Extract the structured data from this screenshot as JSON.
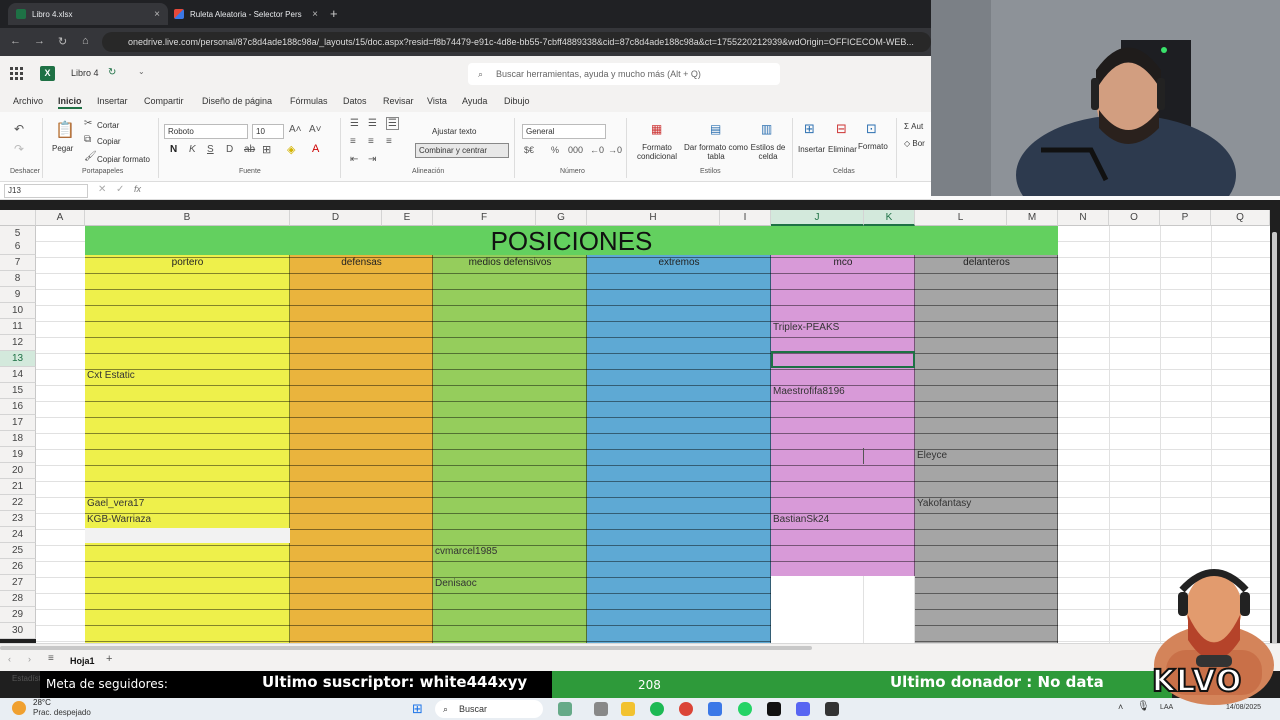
{
  "browser": {
    "tabs": [
      {
        "title": "Libro 4.xlsx",
        "color": "#1e7145"
      },
      {
        "title": "Ruleta Aleatoria - Selector Pers",
        "color": "#e5493a"
      }
    ],
    "url": "onedrive.live.com/personal/87c8d4ade188c98a/_layouts/15/doc.aspx?resid=f8b74479-e91c-4d8e-bb55-7cbff4889338&cid=87c8d4ade188c98a&ct=1755220212939&wdOrigin=OFFICECOM-WEB..."
  },
  "excel": {
    "doc_name": "Libro 4",
    "search_placeholder": "Buscar herramientas, ayuda y mucho más (Alt + Q)",
    "menus": [
      "Archivo",
      "Inicio",
      "Insertar",
      "Compartir",
      "Diseño de página",
      "Fórmulas",
      "Datos",
      "Revisar",
      "Vista",
      "Ayuda",
      "Dibujo"
    ],
    "ribbon": {
      "undo": "Deshacer",
      "paste": "Pegar",
      "cut": "Cortar",
      "copy": "Copiar",
      "format_painter": "Copiar formato",
      "clipboard_group": "Portapapeles",
      "font_name": "Roboto",
      "font_size": "10",
      "font_group": "Fuente",
      "wrap_text": "Ajustar texto",
      "merge_center": "Combinar y centrar",
      "alignment_group": "Alineación",
      "number_format": "General",
      "number_group": "Número",
      "cond_format": "Formato condicional",
      "format_table": "Dar formato como tabla",
      "cell_styles": "Estilos de celda",
      "styles_group": "Estilos",
      "insert": "Insertar",
      "delete": "Eliminar",
      "format": "Formato",
      "cells_group": "Celdas",
      "autosum": "Aut",
      "clear": "Bor"
    },
    "name_box": "J13",
    "columns": [
      "A",
      "B",
      "D",
      "E",
      "F",
      "G",
      "H",
      "I",
      "J",
      "K",
      "L",
      "M",
      "N",
      "O",
      "P",
      "Q"
    ],
    "rows": [
      "5",
      "6",
      "7",
      "8",
      "9",
      "10",
      "11",
      "12",
      "13",
      "14",
      "15",
      "16",
      "17",
      "18",
      "19",
      "20",
      "21",
      "22",
      "23",
      "24",
      "25",
      "26",
      "27",
      "28",
      "29",
      "30"
    ],
    "sheet_title": "POSICIONES",
    "position_headers": [
      "portero",
      "defensas",
      "medios defensivos",
      "extremos",
      "mco",
      "delanteros"
    ],
    "band_colors": {
      "portero": "#eef04b",
      "defensas": "#eab43d",
      "medios": "#95cd5c",
      "extremos": "#5ea9d4",
      "mco": "#d89ad8",
      "delanteros": "#a5a5a5",
      "title": "#63d05f"
    },
    "names": {
      "portero": [
        "Cxt Estatic",
        "Gael_vera17",
        "KGB-Warriaza"
      ],
      "medios": [
        "cvmarcel1985",
        "Denisaoc"
      ],
      "mco": [
        "Triplex-PEAKS",
        "Maestrofifa8196",
        "BastianSk24"
      ],
      "delanteros": [
        "Eleyce",
        "Yakofantasy"
      ]
    },
    "sheet_tab": "Hoja1"
  },
  "overlay": {
    "followers_label": "Meta de seguidores:",
    "last_sub": "Ultimo suscriptor: white444xyy",
    "count": "208",
    "last_donor": "Ultimo donador : No data",
    "brand": "KLVO"
  },
  "taskbar": {
    "temp": "28°C",
    "weather": "Prac. despejado",
    "search": "Buscar",
    "lang": "LAA",
    "date": "14/08/2025",
    "stats_clip": "Estadíst"
  }
}
